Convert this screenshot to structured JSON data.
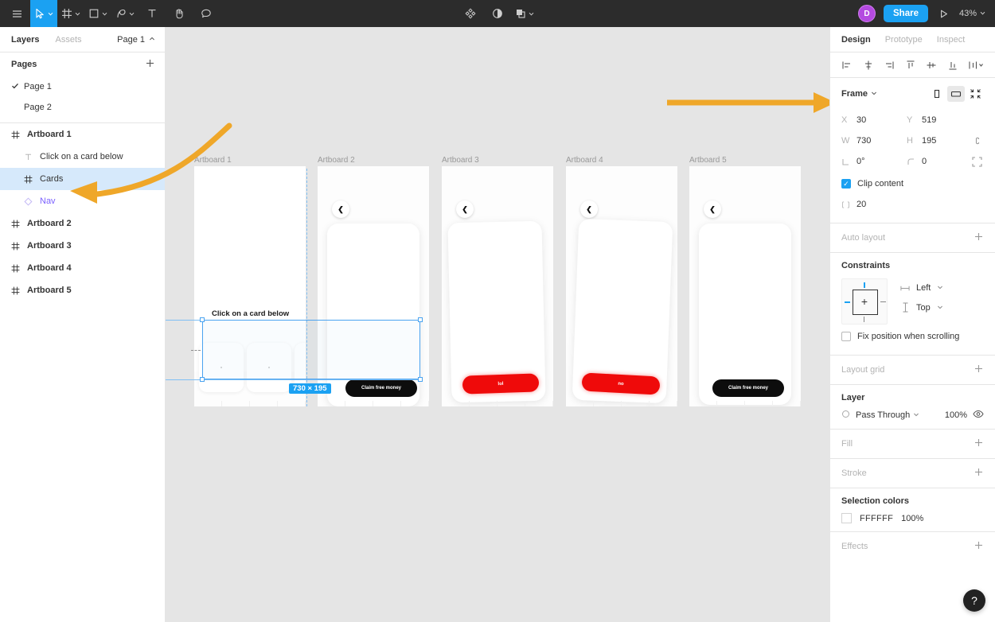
{
  "toolbar": {
    "menu_label": "menu",
    "tools": [
      {
        "name": "move-tool",
        "icon": "cursor",
        "active": true,
        "has_dropdown": true
      },
      {
        "name": "frame-tool",
        "icon": "frame",
        "active": false,
        "has_dropdown": true
      },
      {
        "name": "shape-tool",
        "icon": "square",
        "active": false,
        "has_dropdown": true
      },
      {
        "name": "pen-tool",
        "icon": "pen",
        "active": false,
        "has_dropdown": true
      },
      {
        "name": "text-tool",
        "icon": "text",
        "active": false,
        "has_dropdown": false
      },
      {
        "name": "hand-tool",
        "icon": "hand",
        "active": false,
        "has_dropdown": false
      },
      {
        "name": "comment-tool",
        "icon": "comment",
        "active": false,
        "has_dropdown": false
      }
    ],
    "center_tools": [
      {
        "name": "components-icon",
        "icon": "components"
      },
      {
        "name": "mask-icon",
        "icon": "mask"
      },
      {
        "name": "boolean-icon",
        "icon": "boolean",
        "has_dropdown": true
      }
    ],
    "avatar_initial": "D",
    "avatar_color": "#b44ae0",
    "share_label": "Share",
    "accent_color": "#1ba1f2",
    "zoom_level": "43%"
  },
  "left_panel": {
    "tabs": [
      {
        "label": "Layers",
        "active": true
      },
      {
        "label": "Assets",
        "active": false
      }
    ],
    "page_selector": "Page 1",
    "pages_section_title": "Pages",
    "pages": [
      {
        "label": "Page 1",
        "checked": true
      },
      {
        "label": "Page 2",
        "checked": false
      }
    ],
    "layers": [
      {
        "label": "Artboard 1",
        "icon": "frame-icon",
        "type": "frame",
        "indent": 0,
        "selected": false
      },
      {
        "label": "Click on a card below",
        "icon": "text-icon",
        "type": "text",
        "indent": 1,
        "selected": false
      },
      {
        "label": "Cards",
        "icon": "frame-icon",
        "type": "frame",
        "indent": 1,
        "selected": true
      },
      {
        "label": "Nav",
        "icon": "component-icon",
        "type": "component",
        "indent": 1,
        "selected": false
      },
      {
        "label": "Artboard 2",
        "icon": "frame-icon",
        "type": "frame",
        "indent": 0,
        "selected": false
      },
      {
        "label": "Artboard 3",
        "icon": "frame-icon",
        "type": "frame",
        "indent": 0,
        "selected": false
      },
      {
        "label": "Artboard 4",
        "icon": "frame-icon",
        "type": "frame",
        "indent": 0,
        "selected": false
      },
      {
        "label": "Artboard 5",
        "icon": "frame-icon",
        "type": "frame",
        "indent": 0,
        "selected": false
      }
    ]
  },
  "canvas": {
    "artboards": [
      {
        "label": "Artboard 1",
        "heading": "Click on a card below",
        "button_label": "",
        "button_color": "",
        "has_back": false
      },
      {
        "label": "Artboard 2",
        "heading": "",
        "button_label": "Claim free money",
        "button_color": "#0d0d0d",
        "has_back": true
      },
      {
        "label": "Artboard 3",
        "heading": "",
        "button_label": "lol",
        "button_color": "#ef0a0a",
        "has_back": true
      },
      {
        "label": "Artboard 4",
        "heading": "",
        "button_label": "no",
        "button_color": "#ef0a0a",
        "has_back": true
      },
      {
        "label": "Artboard 5",
        "heading": "",
        "button_label": "Claim free money",
        "button_color": "#0d0d0d",
        "has_back": true
      }
    ],
    "selection_size_badge": "730 × 195"
  },
  "right_panel": {
    "tabs": [
      {
        "label": "Design",
        "active": true
      },
      {
        "label": "Prototype",
        "active": false
      },
      {
        "label": "Inspect",
        "active": false
      }
    ],
    "align_buttons": [
      "align-left",
      "align-horizontal-center",
      "align-right",
      "align-top",
      "align-vertical-center",
      "align-bottom",
      "distribute"
    ],
    "frame": {
      "title": "Frame",
      "orientation_selected": "landscape",
      "x_key": "X",
      "x_value": "30",
      "y_key": "Y",
      "y_value": "519",
      "w_key": "W",
      "w_value": "730",
      "h_key": "H",
      "h_value": "195",
      "rotation_value": "0°",
      "corner_radius_value": "0",
      "clip_content_label": "Clip content",
      "clip_content_checked": true,
      "spacing_value": "20"
    },
    "auto_layout": {
      "title": "Auto layout"
    },
    "constraints": {
      "title": "Constraints",
      "horizontal": "Left",
      "vertical": "Top",
      "fix_position_label": "Fix position when scrolling",
      "fix_position_checked": false
    },
    "layout_grid": {
      "title": "Layout grid"
    },
    "layer": {
      "title": "Layer",
      "blend_mode": "Pass Through",
      "opacity": "100%"
    },
    "fill": {
      "title": "Fill"
    },
    "stroke": {
      "title": "Stroke"
    },
    "selection_colors": {
      "title": "Selection colors",
      "hex": "FFFFFF",
      "opacity": "100%"
    },
    "effects": {
      "title": "Effects"
    },
    "help_label": "?"
  }
}
